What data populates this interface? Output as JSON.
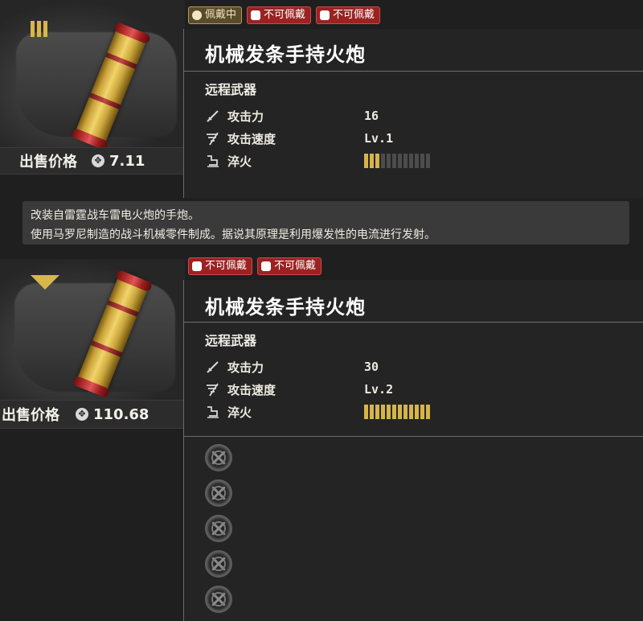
{
  "item1": {
    "tags": [
      {
        "text": "佩戴中",
        "kind": "equip",
        "icon": "equipped-icon"
      },
      {
        "text": "不可佩戴",
        "kind": "no",
        "icon": "forbidden-icon"
      },
      {
        "text": "不可佩戴",
        "kind": "no",
        "icon": "forbidden-icon"
      }
    ],
    "rank_mark": "III",
    "price_label": "出售价格",
    "price_value": "7.11",
    "title": "机械发条手持火炮",
    "type": "远程武器",
    "stats": [
      {
        "label": "攻击力",
        "value": "16",
        "icon": "sword-icon"
      },
      {
        "label": "攻击速度",
        "value": "Lv.1",
        "icon": "speed-icon"
      },
      {
        "label": "淬火",
        "icon": "quench-icon",
        "level": 3,
        "max": 12
      }
    ],
    "description": [
      "改装自雷霆战车雷电火炮的手炮。",
      "使用马罗尼制造的战斗机械零件制成。据说其原理是利用爆发性的电流进行发射。"
    ]
  },
  "item2": {
    "tags": [
      {
        "text": "不可佩戴",
        "kind": "no",
        "icon": "forbidden-icon"
      },
      {
        "text": "不可佩戴",
        "kind": "no",
        "icon": "forbidden-icon"
      }
    ],
    "price_label": "出售价格",
    "price_value": "110.68",
    "title": "机械发条手持火炮",
    "type": "远程武器",
    "stats": [
      {
        "label": "攻击力",
        "value": "30",
        "icon": "sword-icon"
      },
      {
        "label": "攻击速度",
        "value": "Lv.2",
        "icon": "speed-icon"
      },
      {
        "label": "淬火",
        "icon": "quench-icon",
        "level": 12,
        "max": 12
      }
    ],
    "slots": 5
  },
  "colors": {
    "accent_gold": "#d7b44a",
    "forbidden_red": "#9c2222"
  }
}
